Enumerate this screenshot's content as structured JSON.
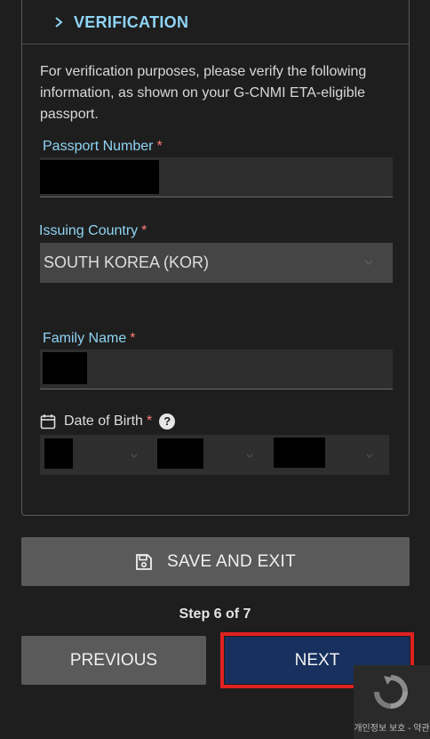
{
  "section": {
    "title": "VERIFICATION",
    "intro": "For verification purposes, please verify the following information, as shown on your G-CNMI ETA-eligible passport."
  },
  "fields": {
    "passport_number": {
      "label": "Passport Number",
      "required_mark": "*"
    },
    "issuing_country": {
      "label": "Issuing Country",
      "required_mark": "*",
      "value": "SOUTH KOREA (KOR)"
    },
    "family_name": {
      "label": "Family Name",
      "required_mark": "*"
    },
    "date_of_birth": {
      "label": "Date of Birth",
      "required_mark": "*",
      "help_glyph": "?"
    }
  },
  "buttons": {
    "save_exit": "SAVE AND EXIT",
    "previous": "PREVIOUS",
    "next": "NEXT"
  },
  "progress": {
    "step_text": "Step 6 of 7",
    "current": 6,
    "total": 7
  },
  "recaptcha": {
    "footer": "개인정보 보호 - 약관"
  },
  "colors": {
    "accent_label": "#8fd4f5",
    "required": "#ff7b7b",
    "next_button": "#17305e",
    "highlight_frame": "#e02121"
  },
  "icons": {
    "header": "chevron-right-icon",
    "dob": "calendar-icon",
    "help": "question-circle-icon",
    "save": "floppy-disk-icon"
  }
}
